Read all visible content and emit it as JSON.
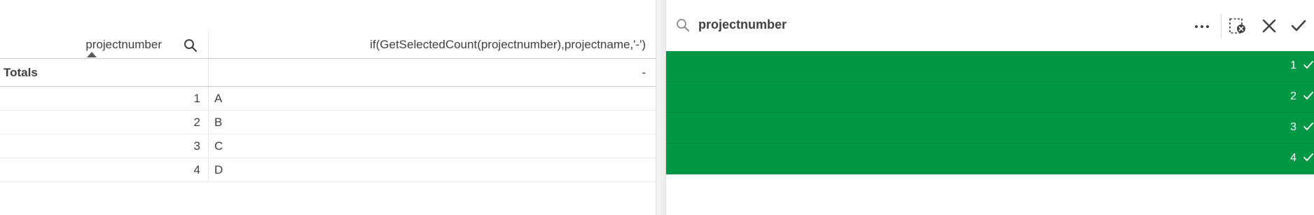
{
  "table": {
    "columns": [
      {
        "label": "projectnumber"
      },
      {
        "label": "if(GetSelectedCount(projectnumber),projectname,'-')"
      }
    ],
    "totals": {
      "label": "Totals",
      "value": "-"
    },
    "rows": [
      {
        "number": "1",
        "name": "A"
      },
      {
        "number": "2",
        "name": "B"
      },
      {
        "number": "3",
        "name": "C"
      },
      {
        "number": "4",
        "name": "D"
      }
    ]
  },
  "listbox": {
    "title": "projectnumber",
    "selected_color": "#009845",
    "items": [
      {
        "value": "1",
        "state": "selected"
      },
      {
        "value": "2",
        "state": "selected"
      },
      {
        "value": "3",
        "state": "selected"
      },
      {
        "value": "4",
        "state": "selected"
      }
    ],
    "actions": [
      "more-icon",
      "clear-selections-icon",
      "cancel-icon",
      "confirm-icon"
    ]
  }
}
